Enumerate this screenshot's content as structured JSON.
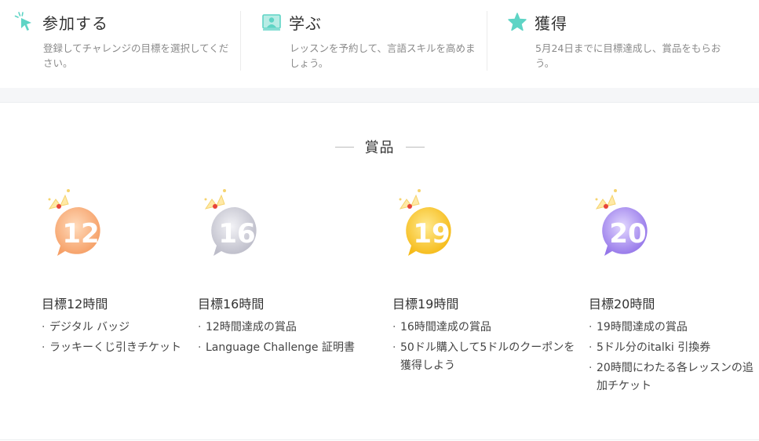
{
  "steps": [
    {
      "title": "参加する",
      "desc": "登録してチャレンジの目標を選択してください。",
      "icon": "cursor-click-icon"
    },
    {
      "title": "学ぶ",
      "desc": "レッスンを予約して、言語スキルを高めましょう。",
      "icon": "person-screen-icon"
    },
    {
      "title": "獲得",
      "desc": "5月24日までに目標達成し、賞品をもらおう。",
      "icon": "star-icon"
    }
  ],
  "prizes_section": {
    "title": "賞品",
    "prizes": [
      {
        "number": "12",
        "name": "目標12時間",
        "perks": [
          "デジタル バッジ",
          "ラッキーくじ引きチケット"
        ],
        "color": "#f6a66f"
      },
      {
        "number": "16",
        "name": "目標16時間",
        "perks": [
          "12時間達成の賞品",
          "Language Challenge 証明書"
        ],
        "color": "#c9c9d4"
      },
      {
        "number": "19",
        "name": "目標19時間",
        "perks": [
          "16時間達成の賞品",
          "50ドル購入して5ドルのクーポンを獲得しよう"
        ],
        "color": "#f7c21a"
      },
      {
        "number": "20",
        "name": "目標20時間",
        "perks": [
          "19時間達成の賞品",
          "5ドル分のitalki 引換券",
          "20時間にわたる各レッスンの追加チケット"
        ],
        "color": "#a78cf0"
      }
    ]
  },
  "colors": {
    "accent_teal": "#5ed4c5",
    "text_muted": "#8a8a8a"
  }
}
